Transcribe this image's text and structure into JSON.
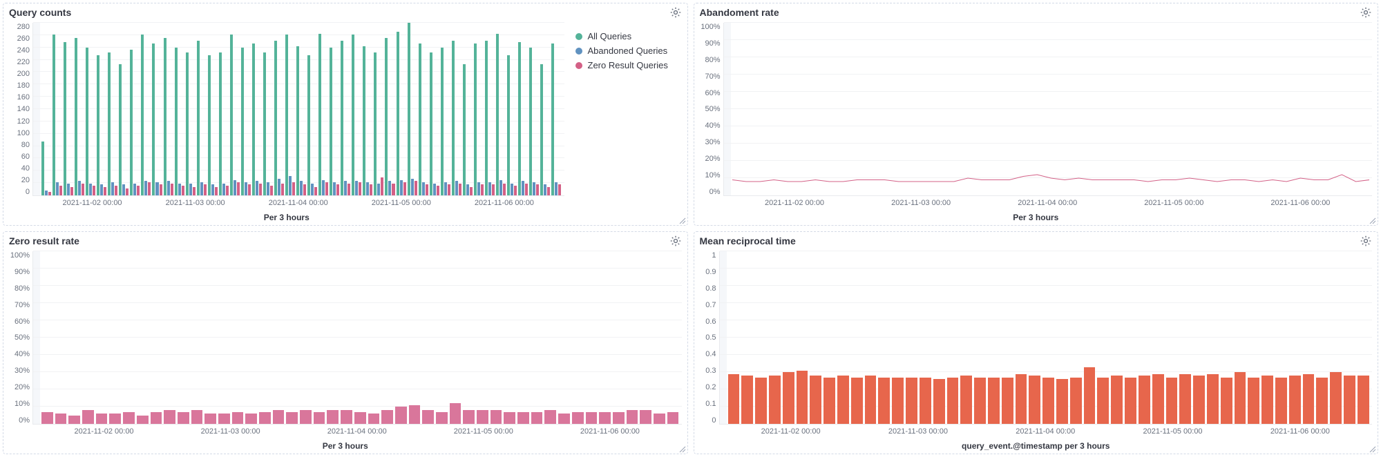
{
  "panels": {
    "query_counts": {
      "title": "Query counts",
      "xlabel": "Per 3 hours",
      "legend": [
        {
          "label": "All Queries",
          "color": "#54b399"
        },
        {
          "label": "Abandoned Queries",
          "color": "#6092c0"
        },
        {
          "label": "Zero Result Queries",
          "color": "#d36086"
        }
      ]
    },
    "abandonment": {
      "title": "Abandoment rate",
      "xlabel": "Per 3 hours"
    },
    "zero_result": {
      "title": "Zero result rate",
      "xlabel": "Per 3 hours"
    },
    "mrt": {
      "title": "Mean reciprocal time",
      "xlabel": "query_event.@timestamp per 3 hours"
    }
  },
  "x_ticks": [
    "2021-11-02 00:00",
    "2021-11-03 00:00",
    "2021-11-04 00:00",
    "2021-11-05 00:00",
    "2021-11-06 00:00"
  ],
  "chart_data": [
    {
      "id": "query_counts",
      "type": "bar",
      "title": "Query counts",
      "xlabel": "Per 3 hours",
      "ylabel": "",
      "ylim": [
        0,
        290
      ],
      "y_ticks": [
        0,
        20,
        40,
        60,
        80,
        100,
        120,
        140,
        160,
        180,
        200,
        220,
        240,
        260,
        280
      ],
      "categories_note": "3-hour buckets 2021-11-01 ~06:00 through 2021-11-06 ~21:00 (47 buckets)",
      "series": [
        {
          "name": "All Queries",
          "color": "#54b399",
          "values": [
            90,
            270,
            258,
            265,
            248,
            235,
            240,
            220,
            245,
            270,
            255,
            265,
            248,
            240,
            260,
            235,
            240,
            270,
            248,
            255,
            240,
            260,
            270,
            250,
            235,
            272,
            248,
            260,
            270,
            250,
            240,
            265,
            275,
            290,
            255,
            240,
            248,
            260,
            220,
            255,
            260,
            272,
            235,
            258,
            248,
            220,
            255
          ]
        },
        {
          "name": "Abandoned Queries",
          "color": "#6092c0",
          "values": [
            8,
            22,
            20,
            24,
            20,
            18,
            22,
            18,
            20,
            24,
            22,
            24,
            20,
            20,
            22,
            18,
            20,
            26,
            22,
            24,
            22,
            28,
            32,
            24,
            20,
            26,
            22,
            24,
            24,
            22,
            20,
            24,
            26,
            28,
            22,
            20,
            22,
            24,
            18,
            22,
            22,
            26,
            20,
            24,
            22,
            18,
            22
          ]
        },
        {
          "name": "Zero Result Queries",
          "color": "#d36086",
          "values": [
            6,
            16,
            14,
            20,
            16,
            14,
            16,
            12,
            16,
            22,
            18,
            20,
            16,
            14,
            18,
            14,
            16,
            22,
            18,
            20,
            16,
            20,
            22,
            18,
            14,
            22,
            18,
            20,
            22,
            18,
            30,
            20,
            22,
            24,
            18,
            16,
            18,
            20,
            14,
            18,
            18,
            20,
            16,
            20,
            18,
            14,
            18
          ]
        }
      ]
    },
    {
      "id": "abandonment",
      "type": "line",
      "title": "Abandoment rate",
      "xlabel": "Per 3 hours",
      "ylabel": "",
      "ylim": [
        0,
        100
      ],
      "y_unit": "%",
      "y_ticks": [
        0,
        10,
        20,
        30,
        40,
        50,
        60,
        70,
        80,
        90,
        100
      ],
      "series": [
        {
          "name": "Abandonment rate",
          "color": "#d36086",
          "values": [
            9,
            8,
            8,
            9,
            8,
            8,
            9,
            8,
            8,
            9,
            9,
            9,
            8,
            8,
            8,
            8,
            8,
            10,
            9,
            9,
            9,
            11,
            12,
            10,
            9,
            10,
            9,
            9,
            9,
            9,
            8,
            9,
            9,
            10,
            9,
            8,
            9,
            9,
            8,
            9,
            8,
            10,
            9,
            9,
            12,
            8,
            9
          ]
        }
      ]
    },
    {
      "id": "zero_result",
      "type": "bar",
      "title": "Zero result rate",
      "xlabel": "Per 3 hours",
      "ylabel": "",
      "ylim": [
        0,
        100
      ],
      "y_unit": "%",
      "y_ticks": [
        0,
        10,
        20,
        30,
        40,
        50,
        60,
        70,
        80,
        90,
        100
      ],
      "series": [
        {
          "name": "Zero result rate",
          "color": "#d9769b",
          "values": [
            7,
            6,
            5,
            8,
            6,
            6,
            7,
            5,
            7,
            8,
            7,
            8,
            6,
            6,
            7,
            6,
            7,
            8,
            7,
            8,
            7,
            8,
            8,
            7,
            6,
            8,
            10,
            11,
            8,
            7,
            12,
            8,
            8,
            8,
            7,
            7,
            7,
            8,
            6,
            7,
            7,
            7,
            7,
            8,
            8,
            6,
            7
          ]
        }
      ]
    },
    {
      "id": "mrt",
      "type": "bar",
      "title": "Mean reciprocal time",
      "xlabel": "query_event.@timestamp per 3 hours",
      "ylabel": "",
      "ylim": [
        0,
        1
      ],
      "y_ticks": [
        0,
        0.1,
        0.2,
        0.3,
        0.4,
        0.5,
        0.6,
        0.7,
        0.8,
        0.9,
        1
      ],
      "series": [
        {
          "name": "MRT",
          "color": "#e7664c",
          "values": [
            0.29,
            0.28,
            0.27,
            0.28,
            0.3,
            0.31,
            0.28,
            0.27,
            0.28,
            0.27,
            0.28,
            0.27,
            0.27,
            0.27,
            0.27,
            0.26,
            0.27,
            0.28,
            0.27,
            0.27,
            0.27,
            0.29,
            0.28,
            0.27,
            0.26,
            0.27,
            0.33,
            0.27,
            0.28,
            0.27,
            0.28,
            0.29,
            0.27,
            0.29,
            0.28,
            0.29,
            0.27,
            0.3,
            0.27,
            0.28,
            0.27,
            0.28,
            0.29,
            0.27,
            0.3,
            0.28,
            0.28
          ]
        }
      ]
    }
  ]
}
